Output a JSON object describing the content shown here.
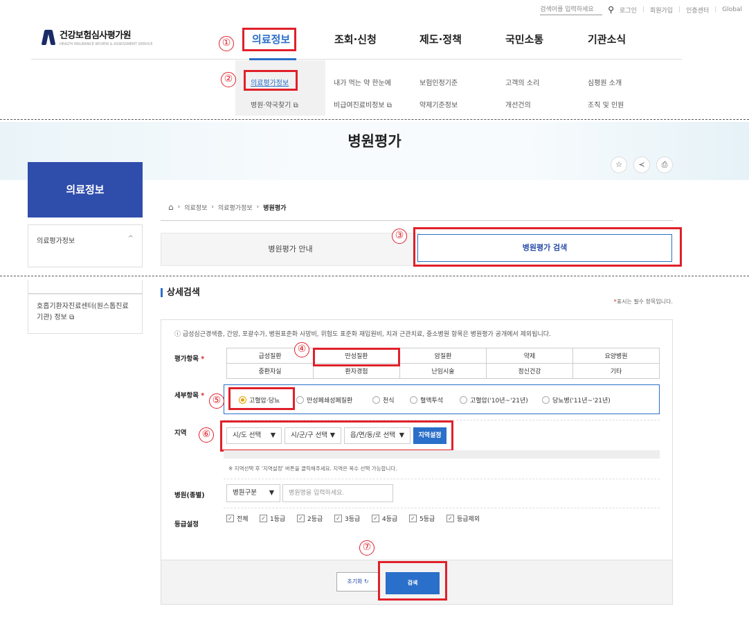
{
  "utility": {
    "search_placeholder": "검색어를 입력하세요",
    "login": "로그인",
    "join": "회원가입",
    "cert": "인증센터",
    "global": "Global"
  },
  "logo": {
    "name": "건강보험심사평가원",
    "sub": "HEALTH INSURANCE REVIEW & ASSESSMENT SERVICE"
  },
  "gnb": [
    "의료정보",
    "조회·신청",
    "제도·정책",
    "국민소통",
    "기관소식"
  ],
  "submenu": {
    "row1": [
      "의료평가정보",
      "내가 먹는 약 한눈에",
      "보험인정기준",
      "고객의 소리",
      "심평원 소개"
    ],
    "row2": [
      "병원·약국찾기",
      "비급여진료비정보",
      "약제기준정보",
      "개선건의",
      "조직 및 인원"
    ]
  },
  "markers": [
    "①",
    "②",
    "③",
    "④",
    "⑤",
    "⑥",
    "⑦"
  ],
  "page_title": "병원평가",
  "tools": {
    "favorite": "☆",
    "share": "≺",
    "print": "⎙"
  },
  "sidebar": {
    "title": "의료정보",
    "item1": "의료평가정보",
    "item1_arrow": "^",
    "item2": "호흡기환자진료센터(원스톱진료기관) 정보"
  },
  "breadcrumb": [
    "의료정보",
    "의료평가정보",
    "병원평가"
  ],
  "tabs": {
    "guide": "병원평가 안내",
    "search": "병원평가 검색"
  },
  "section_title": "상세검색",
  "required_note": {
    "star": "*",
    "text": "표시는 필수 항목입니다."
  },
  "notice": "ⓘ 급성심근경색증, 간암, 포괄수가, 병원표준화 사망비, 위험도 표준화 재입원비, 치과 근관치료, 중소병원 항목은 병원평가 공개에서 제외됩니다.",
  "labels": {
    "eval_item": "평가항목",
    "detail_item": "세부항목",
    "region": "지역",
    "hospital_type": "병원(종별)",
    "grade": "등급설정",
    "star": "*"
  },
  "eval_items": {
    "row1": [
      "급성질환",
      "만성질환",
      "암질환",
      "약제",
      "요양병원"
    ],
    "row2": [
      "중환자실",
      "환자경험",
      "난임시술",
      "정신건강",
      "기타"
    ]
  },
  "detail_items": [
    "고혈압·당뇨",
    "만성폐쇄성폐질환",
    "천식",
    "혈액투석",
    "고혈압('10년~'21년)",
    "당뇨병('11년~'21년)"
  ],
  "detail_selected": "고혈압·당뇨",
  "region": {
    "sido": "시/도 선택",
    "sigungu": "시/군/구 선택",
    "eupmyeondong": "읍/면/동/로 선택",
    "set_button": "지역설정",
    "hint": "※ 지역선택 후 '지역설정' 버튼을 클릭해주세요. 지역은 복수 선택 가능합니다."
  },
  "hospital": {
    "type_select": "병원구분",
    "name_placeholder": "병원명을 입력하세요."
  },
  "grades": [
    "전체",
    "1등급",
    "2등급",
    "3등급",
    "4등급",
    "5등급",
    "등급제외"
  ],
  "buttons": {
    "reset": "초기화",
    "search": "검색"
  },
  "colors": {
    "accent": "#2a6fc9",
    "marker_red": "#e0202a",
    "sidebar_blue": "#2f4dab"
  }
}
